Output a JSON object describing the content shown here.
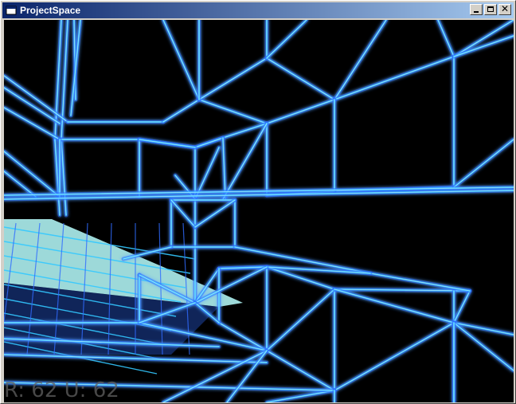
{
  "window": {
    "title": "ProjectSpace",
    "icon": "app-window-icon",
    "controls": {
      "minimize": "minimize-icon",
      "maximize": "maximize-icon",
      "close": "close-icon"
    }
  },
  "scene": {
    "style": "wireframe",
    "background_color": "#000000",
    "line_color": "#2f6bff",
    "glow_color": "#33c8ff",
    "floor_color": "#b8ffff"
  },
  "hud": {
    "text": "R: 62 U: 62"
  }
}
